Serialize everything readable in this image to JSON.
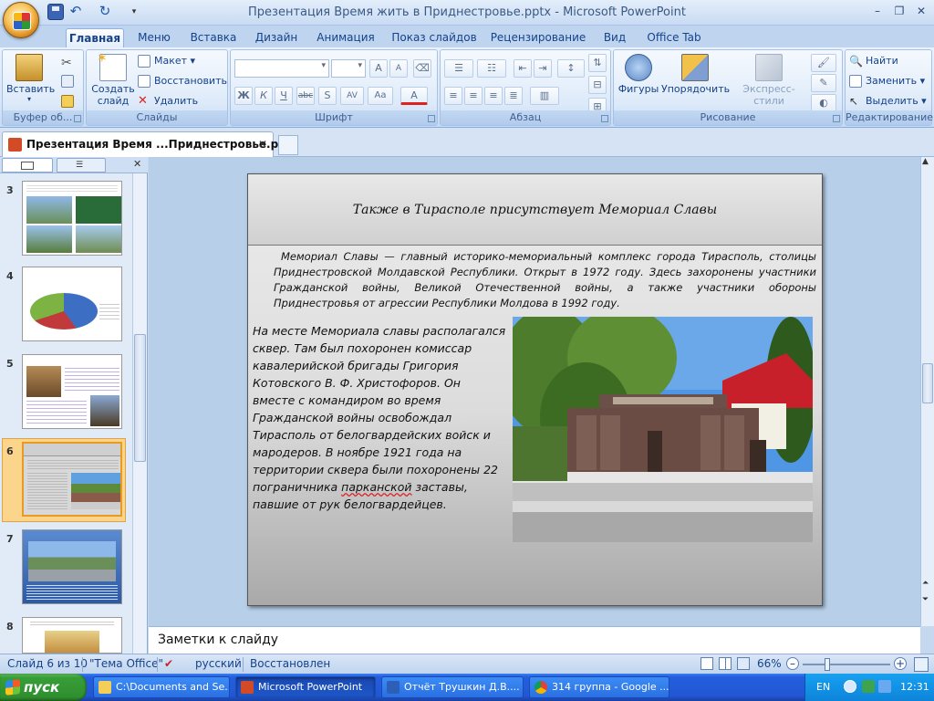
{
  "window": {
    "title": "Презентация  Время жить в Приднестровье.pptx - Microsoft PowerPoint",
    "minimize": "–",
    "maximize": "❐",
    "close": "✕"
  },
  "ribbon_tabs": [
    "Главная",
    "Меню",
    "Вставка",
    "Дизайн",
    "Анимация",
    "Показ слайдов",
    "Рецензирование",
    "Вид",
    "Office Tab"
  ],
  "ribbon": {
    "clipboard": {
      "label": "Буфер об...",
      "paste": "Вставить"
    },
    "slides": {
      "label": "Слайды",
      "new_slide_1": "Создать",
      "new_slide_2": "слайд",
      "layout": "Макет",
      "reset": "Восстановить",
      "delete": "Удалить"
    },
    "font": {
      "label": "Шрифт",
      "bold": "Ж",
      "italic": "К",
      "underline": "Ч",
      "strike": "abc",
      "shadow": "S",
      "spacing": "AV",
      "case": "Aa",
      "color": "A",
      "grow": "A",
      "shrink": "A"
    },
    "paragraph": {
      "label": "Абзац"
    },
    "drawing": {
      "label": "Рисование",
      "shapes": "Фигуры",
      "arrange": "Упорядочить",
      "quick_styles": "Экспресс-стили"
    },
    "editing": {
      "label": "Редактирование",
      "find": "Найти",
      "replace": "Заменить",
      "select": "Выделить"
    }
  },
  "doc_tab": {
    "title": "Презентация  Время ...Приднестровье.pptx",
    "close": "✕"
  },
  "thumbnails": [
    {
      "num": "3"
    },
    {
      "num": "4"
    },
    {
      "num": "5"
    },
    {
      "num": "6",
      "selected": true
    },
    {
      "num": "7"
    },
    {
      "num": "8"
    }
  ],
  "slide": {
    "title": "Также в Тирасполе присутствует Мемориал Славы",
    "paragraph": "Мемориал Славы — главный историко-мемориальный комплекс города Тирасполь, столицы Приднестровской Молдавской Республики. Открыт в 1972 году. Здесь захоронены участники Гражданской войны, Великой Отечественной войны, а также участники обороны Приднестровья от агрессии Республики Молдова в 1992 году.",
    "body_before": "На месте Мемориала славы располагался сквер. Там был похоронен комиссар кавалерийской бригады Григория Котовского В. Ф. Христофоров. Он вместе с командиром во время Гражданской войны освобождал Тирасполь от белогвардейских войск и мародеров. В ноябре 1921 года на территории сквера были похоронены 22 пограничника ",
    "body_squiggle": "парканской",
    "body_after": " заставы, павшие от рук белогвардейцев."
  },
  "notes": {
    "placeholder": "Заметки к слайду"
  },
  "status": {
    "slide_info": "Слайд 6 из 10",
    "theme": "\"Тема Office\"",
    "language": "русский",
    "restored": "Восстановлен",
    "zoom": "66%"
  },
  "taskbar": {
    "start": "пуск",
    "items": [
      {
        "label": "C:\\Documents and Se..."
      },
      {
        "label": "Microsoft PowerPoint",
        "active": true
      },
      {
        "label": "Отчёт Трушкин Д.В...."
      },
      {
        "label": "314 группа - Google ..."
      }
    ],
    "lang": "EN",
    "clock": "12:31"
  },
  "colors": {
    "accent": "#15428b",
    "ribbon": "#d7e6f8",
    "taskbar": "#245edc",
    "start": "#379e37"
  }
}
